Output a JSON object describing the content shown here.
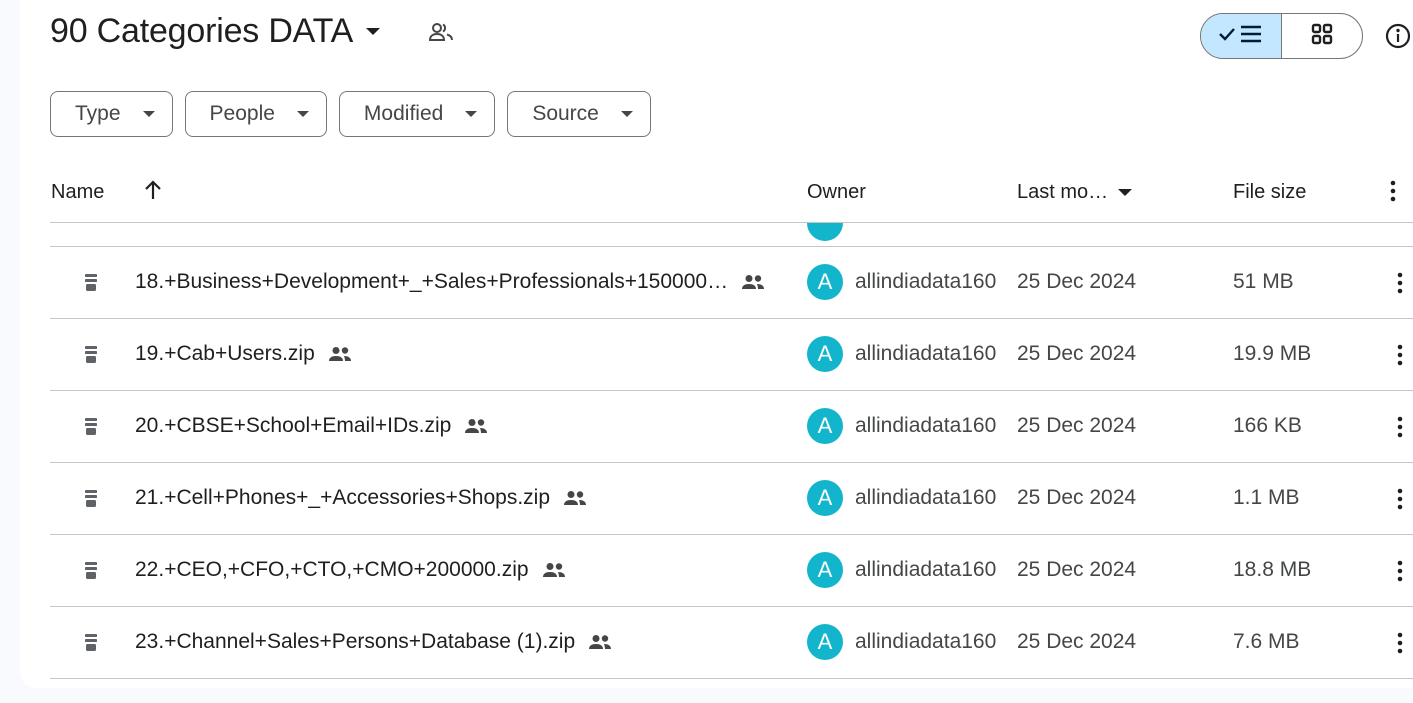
{
  "folder": {
    "title": "90 Categories DATA",
    "shared_icon": "people-icon"
  },
  "view": {
    "list_icon": "check-list-icon",
    "grid_icon": "grid-icon",
    "info_icon": "info-icon"
  },
  "filters": [
    {
      "label": "Type"
    },
    {
      "label": "People"
    },
    {
      "label": "Modified"
    },
    {
      "label": "Source"
    }
  ],
  "columns": {
    "name": "Name",
    "owner": "Owner",
    "modified": "Last mo…",
    "size": "File size"
  },
  "files": [
    {
      "name": "18.+Business+Development+_+Sales+Professionals+150000…",
      "owner_initial": "A",
      "owner": "allindiadata160",
      "modified": "25 Dec 2024",
      "size": "51 MB"
    },
    {
      "name": "19.+Cab+Users.zip",
      "owner_initial": "A",
      "owner": "allindiadata160",
      "modified": "25 Dec 2024",
      "size": "19.9 MB"
    },
    {
      "name": "20.+CBSE+School+Email+IDs.zip",
      "owner_initial": "A",
      "owner": "allindiadata160",
      "modified": "25 Dec 2024",
      "size": "166 KB"
    },
    {
      "name": "21.+Cell+Phones+_+Accessories+Shops.zip",
      "owner_initial": "A",
      "owner": "allindiadata160",
      "modified": "25 Dec 2024",
      "size": "1.1 MB"
    },
    {
      "name": "22.+CEO,+CFO,+CTO,+CMO+200000.zip",
      "owner_initial": "A",
      "owner": "allindiadata160",
      "modified": "25 Dec 2024",
      "size": "18.8 MB"
    },
    {
      "name": "23.+Channel+Sales+Persons+Database (1).zip",
      "owner_initial": "A",
      "owner": "allindiadata160",
      "modified": "25 Dec 2024",
      "size": "7.6 MB"
    }
  ],
  "colors": {
    "avatar": "#12b5cb",
    "active_view": "#c2e7ff",
    "divider": "#c4c7c5"
  }
}
